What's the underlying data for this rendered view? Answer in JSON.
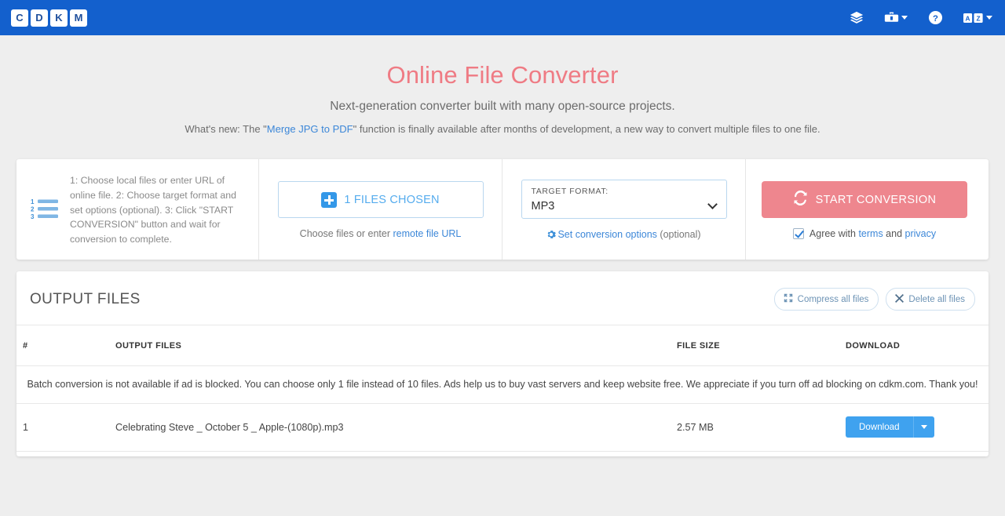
{
  "navbar": {
    "logo_letters": [
      "C",
      "D",
      "K",
      "M"
    ],
    "icons": [
      {
        "name": "layers-icon",
        "label": "Layers"
      },
      {
        "name": "toolbox-icon",
        "label": "Tools"
      },
      {
        "name": "help-circle-icon",
        "label": "Help"
      },
      {
        "name": "language-icon",
        "label": "Language"
      }
    ],
    "brand_color": "#1360cd"
  },
  "hero": {
    "title": "Online File Converter",
    "subtitle": "Next-generation converter built with many open-source projects.",
    "whatsnew_prefix": "What's new: The \"",
    "whatsnew_link": "Merge JPG to PDF",
    "whatsnew_suffix": "\" function is finally available after months of development, a new way to convert multiple files to one file.",
    "title_color": "#ef7b84"
  },
  "converter": {
    "instructions": "1: Choose local files or enter URL of online file. 2: Choose target format and set options (optional). 3: Click \"START CONVERSION\" button and wait for conversion to complete.",
    "choose": {
      "button_label": "1 FILES CHOSEN",
      "note_prefix": "Choose files or enter ",
      "note_link": "remote file URL"
    },
    "format": {
      "label": "TARGET FORMAT:",
      "value": "MP3",
      "options_link": "Set conversion options",
      "options_suffix": "(optional)"
    },
    "start": {
      "button_label": "START CONVERSION",
      "button_color": "#ee868e",
      "agree_prefix": "Agree with ",
      "agree_terms": "terms",
      "agree_mid": " and ",
      "agree_privacy": "privacy",
      "checked": true
    }
  },
  "output": {
    "title": "OUTPUT FILES",
    "compress_label": "Compress all files",
    "delete_label": "Delete all files",
    "columns": [
      "#",
      "OUTPUT FILES",
      "FILE SIZE",
      "DOWNLOAD"
    ],
    "notice": "Batch conversion is not available if ad is blocked. You can choose only 1 file instead of 10 files. Ads help us to buy vast servers and keep website free. We appreciate if you turn off ad blocking on cdkm.com. Thank you!",
    "notice_color": "#ef8a92",
    "rows": [
      {
        "index": "1",
        "name": "Celebrating Steve _ October 5 _ Apple-(1080p).mp3",
        "size": "2.57 MB",
        "download_label": "Download"
      }
    ]
  }
}
